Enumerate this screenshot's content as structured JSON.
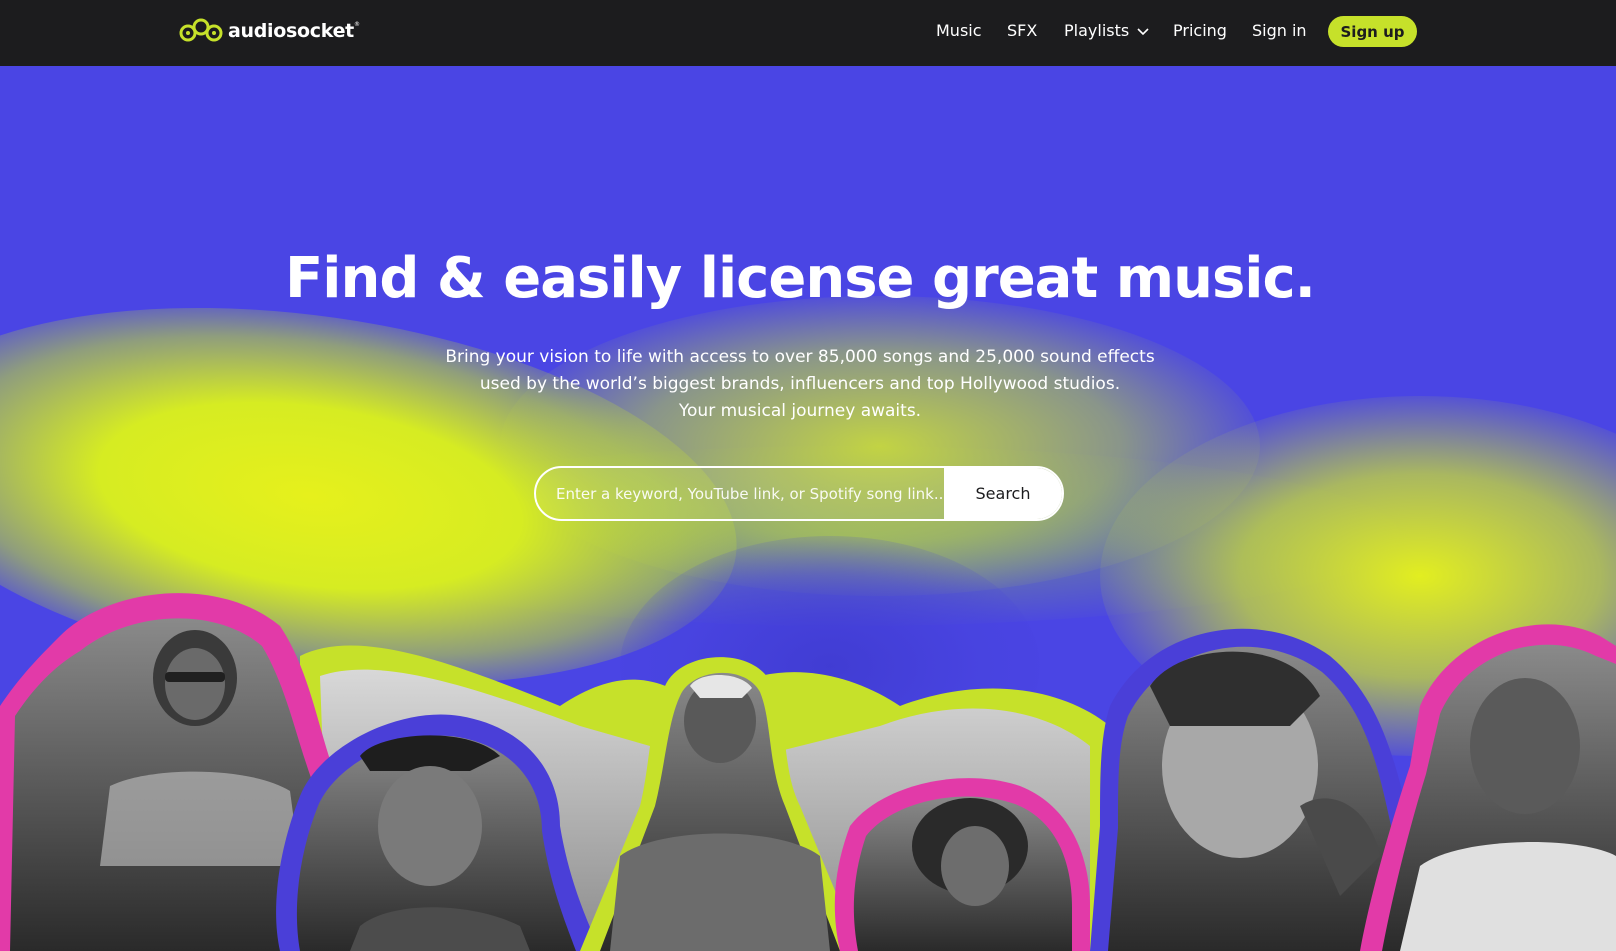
{
  "nav": {
    "logo_text": "audiosocket",
    "logo_icon": "audiosocket-logo-icon",
    "links": {
      "music": "Music",
      "sfx": "SFX",
      "playlists": "Playlists",
      "pricing": "Pricing",
      "sign_in": "Sign in"
    },
    "sign_up": "Sign up"
  },
  "hero": {
    "title": "Find & easily license great music.",
    "subtitle_lines": [
      "Bring your vision to life with access to over 85,000 songs and 25,000 sound effects",
      "used by the world’s biggest brands, influencers and top Hollywood studios.",
      "Your musical journey awaits."
    ]
  },
  "search": {
    "placeholder": "Enter a keyword, YouTube link, or Spotify song link...",
    "value": "",
    "button_label": "Search"
  },
  "colors": {
    "nav_bg": "#1c1c1e",
    "accent_lime": "#c6e12a",
    "hero_blue": "#4a45e4",
    "hero_yellow": "#e6f01c",
    "outline_pink": "#e23aa8",
    "outline_indigo": "#4a3fd8"
  }
}
